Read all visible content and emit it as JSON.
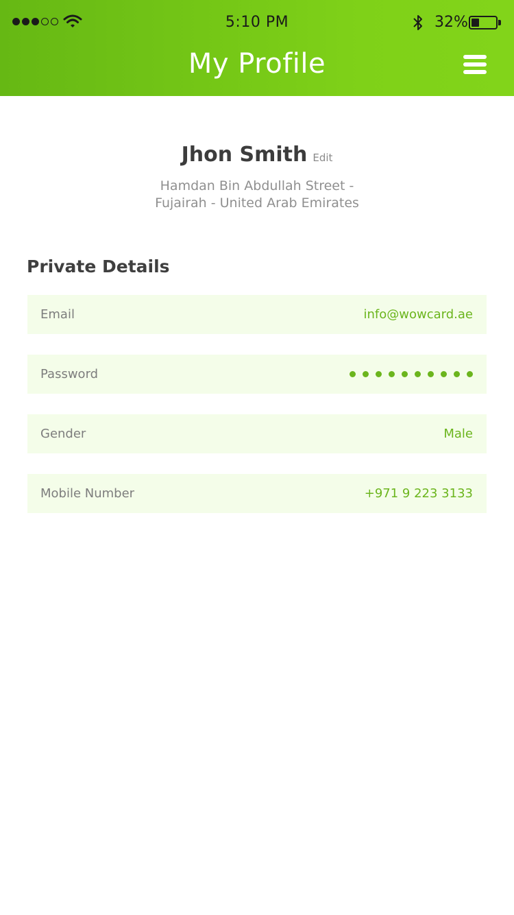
{
  "status_bar": {
    "time": "5:10 PM",
    "battery_percent": "32%",
    "battery_level": 0.32,
    "signal_bars_filled": 3,
    "signal_bars_total": 5,
    "icons": [
      "signal-icon",
      "wifi-icon",
      "bluetooth-icon",
      "battery-icon"
    ]
  },
  "header": {
    "title": "My Profile",
    "menu_icon": "hamburger-menu-icon",
    "gradient_colors": [
      "#66b814",
      "#82d41a"
    ]
  },
  "profile": {
    "name": "Jhon Smith",
    "edit_label": "Edit",
    "address_line1": "Hamdan Bin Abdullah Street -",
    "address_line2": "Fujairah - United Arab Emirates"
  },
  "private_details": {
    "title": "Private Details",
    "rows": [
      {
        "label": "Email",
        "value": "info@wowcard.ae"
      },
      {
        "label": "Password",
        "value_mask_count": 10
      },
      {
        "label": "Gender",
        "value": "Male"
      },
      {
        "label": "Mobile Number",
        "value": "+971 9 223 3133"
      }
    ]
  },
  "colors": {
    "accent": "#6bb51d",
    "row_background": "#f4fde9",
    "label_text": "#7d7d7d",
    "heading_text": "#3c3c3c"
  }
}
